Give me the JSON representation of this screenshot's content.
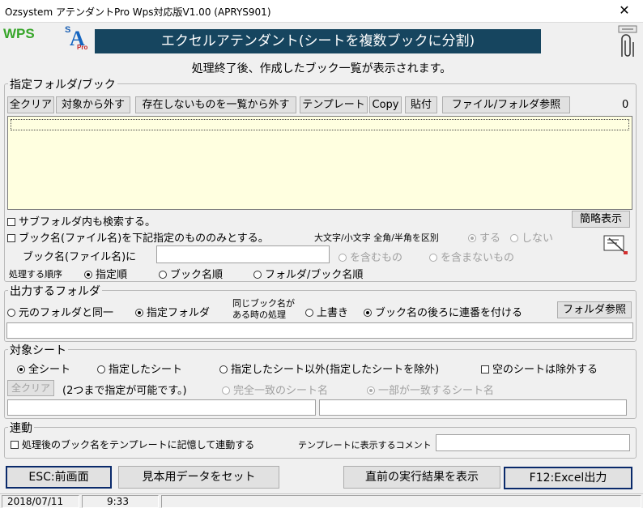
{
  "window": {
    "title": "Ozsystem アテンダントPro Wps対応版V1.00 (APRYS901)",
    "close_symbol": "✕"
  },
  "logos": {
    "wps": "WPS",
    "sa_s": "S",
    "sa_a": "A",
    "sa_pro": "Pro"
  },
  "banner": "エクセルアテンダント(シートを複数ブックに分割)",
  "subtitle": "処理終了後、作成したブック一覧が表示されます。",
  "folder_section": {
    "legend": "指定フォルダ/ブック",
    "buttons": [
      "全クリア",
      "対象から外す",
      "存在しないものを一覧から外す",
      "テンプレート",
      "Copy",
      "貼付",
      "ファイル/フォルダ参照"
    ],
    "count": "0",
    "subfolder_label": "サブフォルダ内も検索する。",
    "brief_button": "簡略表示",
    "bookname_only_label": "ブック名(ファイル名)を下記指定のもののみとする。",
    "case_label": "大文字/小文字 全角/半角を区別",
    "case_yes": "する",
    "case_no": "しない",
    "bookname_label": "ブック名(ファイル名)に",
    "bookname_value": "",
    "contains": "を含むもの",
    "not_contains": "を含まないもの",
    "order_label": "処理する順序",
    "order_options": [
      "指定順",
      "ブック名順",
      "フォルダ/ブック名順"
    ]
  },
  "output_section": {
    "legend": "出力するフォルダ",
    "same_folder": "元のフォルダと同一",
    "specified_folder": "指定フォルダ",
    "same_name_line1": "同じブック名が",
    "same_name_line2": "ある時の処理",
    "overwrite": "上書き",
    "append_number": "ブック名の後ろに連番を付ける",
    "folder_browse": "フォルダ参照",
    "folder_value": ""
  },
  "sheet_section": {
    "legend": "対象シート",
    "all_sheets": "全シート",
    "specified_sheets": "指定したシート",
    "except_specified": "指定したシート以外(指定したシートを除外)",
    "exclude_empty": "空のシートは除外する",
    "clear_button": "全クリア",
    "note": "(2つまで指定が可能です。)",
    "exact_match": "完全一致のシート名",
    "partial_match": "一部が一致するシート名",
    "sheet1_value": "",
    "sheet2_value": ""
  },
  "link_section": {
    "legend": "連動",
    "remember_label": "処理後のブック名をテンプレートに記憶して連動する",
    "comment_label": "テンプレートに表示するコメント",
    "comment_value": ""
  },
  "footer_buttons": {
    "esc": "ESC:前画面",
    "sample": "見本用データをセット",
    "last_result": "直前の実行結果を表示",
    "f12": "F12:Excel出力"
  },
  "status": {
    "date": "2018/07/11",
    "time": "9:33"
  },
  "colors": {
    "banner": "#16455f",
    "list_bg": "#ffffe0",
    "wps_green": "#38a62b"
  }
}
